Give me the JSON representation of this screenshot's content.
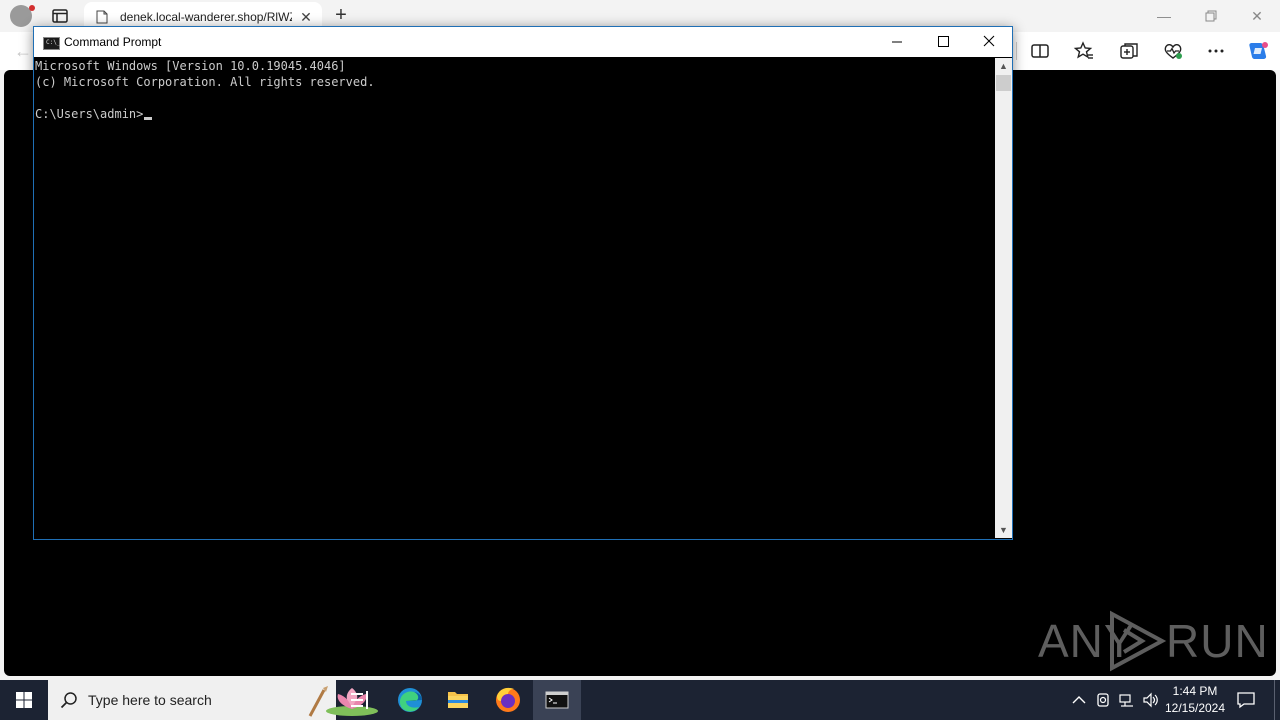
{
  "browser": {
    "tab_title": "denek.local-wanderer.shop/RlWZ",
    "tab_close": "✕",
    "new_tab": "+"
  },
  "cmd": {
    "title": "Command Prompt",
    "icon_text": "C:\\_",
    "lines": [
      "Microsoft Windows [Version 10.0.19045.4046]",
      "(c) Microsoft Corporation. All rights reserved.",
      "",
      "C:\\Users\\admin>"
    ]
  },
  "watermark": {
    "left": "ANY",
    "right": "RUN"
  },
  "taskbar": {
    "search_placeholder": "Type here to search",
    "time": "1:44 PM",
    "date": "12/15/2024"
  },
  "colors": {
    "taskbar_bg": "#1c2333",
    "cmd_text": "#cccccc",
    "accent": "#1f6fb5"
  }
}
